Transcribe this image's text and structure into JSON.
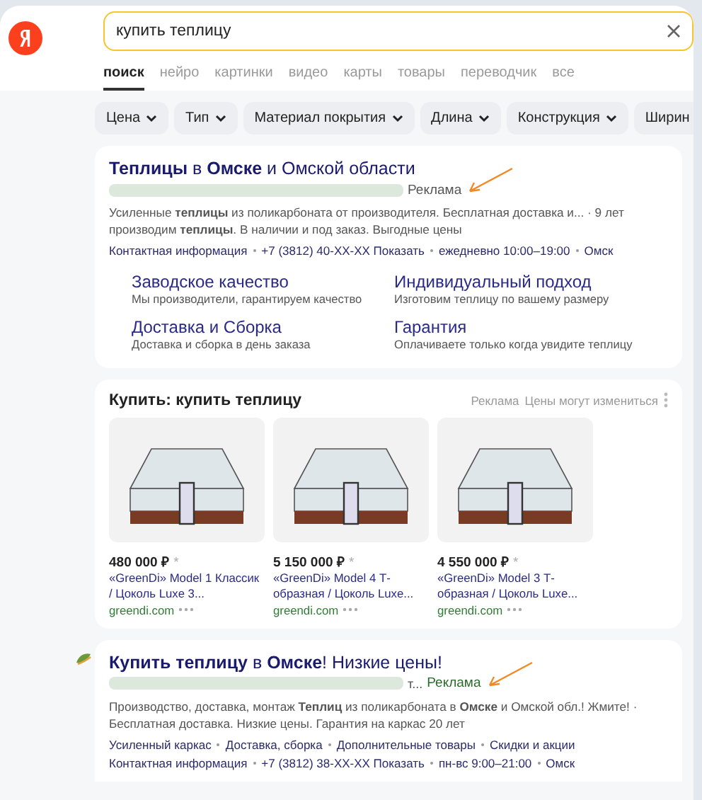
{
  "search": {
    "value": "купить теплицу"
  },
  "tabs": [
    {
      "label": "поиск",
      "selected": true
    },
    {
      "label": "нейро",
      "selected": false
    },
    {
      "label": "картинки",
      "selected": false
    },
    {
      "label": "видео",
      "selected": false
    },
    {
      "label": "карты",
      "selected": false
    },
    {
      "label": "товары",
      "selected": false
    },
    {
      "label": "переводчик",
      "selected": false
    },
    {
      "label": "все",
      "selected": false
    }
  ],
  "filters": [
    "Цена",
    "Тип",
    "Материал покрытия",
    "Длина",
    "Конструкция",
    "Ширин"
  ],
  "ad1": {
    "title": "**Теплицы** в **Омске** и Омской области",
    "ad_label": "Реклама",
    "description": "Усиленные **теплицы** из поликарбоната от производителя. Бесплатная доставка и... · 9 лет производим **теплицы**. В наличии и под заказ. Выгодные цены",
    "meta": [
      "Контактная информация",
      "+7 (3812) 40-XX-XX Показать",
      "ежедневно 10:00–19:00",
      "Омск"
    ],
    "sitelinks": [
      {
        "title": "Заводское качество",
        "text": "Мы производители, гарантируем качество"
      },
      {
        "title": "Индивидуальный подход",
        "text": "Изготовим теплицу по вашему размеру"
      },
      {
        "title": "Доставка и Сборка",
        "text": "Доставка и сборка в день заказа"
      },
      {
        "title": "Гарантия",
        "text": "Оплачиваете только когда увидите теплицу"
      }
    ]
  },
  "products": {
    "title": "Купить: купить теплицу",
    "ad_label": "Реклама",
    "note": "Цены могут измениться",
    "items": [
      {
        "price": "480 000 ₽",
        "mark": "*",
        "name": "«GreenDi» Model 1 Классик / Цоколь Luxe 3...",
        "domain": "greendi.com"
      },
      {
        "price": "5 150 000 ₽",
        "mark": "*",
        "name": "«GreenDi» Model 4 Т-образная / Цоколь Luxe...",
        "domain": "greendi.com"
      },
      {
        "price": "4 550 000 ₽",
        "mark": "*",
        "name": "«GreenDi» Model 3 Т-образная / Цоколь Luxe...",
        "domain": "greendi.com"
      }
    ]
  },
  "ad2": {
    "title": "**Купить теплицу** в **Омске**! Низкие цены!",
    "url_tail": "т...",
    "ad_label": "Реклама",
    "description": "Производство, доставка, монтаж **Теплиц** из поликарбоната в **Омске** и Омской обл.! Жмите! · Бесплатная доставка. Низкие цены. Гарантия на каркас 20 лет",
    "links": [
      "Усиленный каркас",
      "Доставка, сборка",
      "Дополнительные товары",
      "Скидки и акции"
    ],
    "meta": [
      "Контактная информация",
      "+7 (3812) 38-XX-XX Показать",
      "пн-вс 9:00–21:00",
      "Омск"
    ]
  }
}
